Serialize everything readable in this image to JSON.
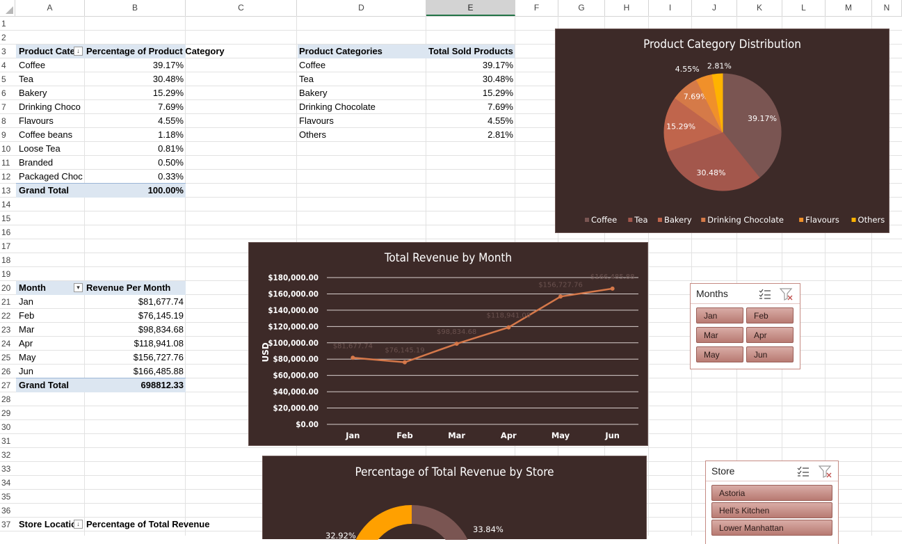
{
  "columns": [
    "A",
    "B",
    "C",
    "D",
    "E",
    "F",
    "G",
    "H",
    "I",
    "J",
    "K",
    "L",
    "M",
    "N"
  ],
  "selected_column": "E",
  "rows": [
    "1",
    "2",
    "3",
    "4",
    "5",
    "6",
    "7",
    "8",
    "9",
    "10",
    "11",
    "12",
    "13",
    "14",
    "15",
    "16",
    "17",
    "18",
    "19",
    "20",
    "21",
    "22",
    "23",
    "24",
    "25",
    "26",
    "27",
    "28",
    "29",
    "30",
    "31",
    "32",
    "33",
    "34",
    "35",
    "36",
    "37"
  ],
  "pivot_category": {
    "header_a": "Product Cate",
    "header_b": "Percentage of Product Category",
    "rows": [
      {
        "name": "Coffee",
        "pct": "39.17%"
      },
      {
        "name": "Tea",
        "pct": "30.48%"
      },
      {
        "name": "Bakery",
        "pct": "15.29%"
      },
      {
        "name": "Drinking Choco",
        "pct": "7.69%"
      },
      {
        "name": "Flavours",
        "pct": "4.55%"
      },
      {
        "name": "Coffee beans",
        "pct": "1.18%"
      },
      {
        "name": "Loose Tea",
        "pct": "0.81%"
      },
      {
        "name": "Branded",
        "pct": "0.50%"
      },
      {
        "name": "Packaged Choc",
        "pct": "0.33%"
      }
    ],
    "total_label": "Grand Total",
    "total_value": "100.00%"
  },
  "table_categories": {
    "header_d": "Product Categories",
    "header_e": "Total Sold Products",
    "rows": [
      {
        "name": "Coffee",
        "pct": "39.17%"
      },
      {
        "name": "Tea",
        "pct": "30.48%"
      },
      {
        "name": "Bakery",
        "pct": "15.29%"
      },
      {
        "name": "Drinking Chocolate",
        "pct": "7.69%"
      },
      {
        "name": "Flavours",
        "pct": "4.55%"
      },
      {
        "name": "Others",
        "pct": "2.81%"
      }
    ]
  },
  "pivot_month": {
    "header_a": "Month",
    "header_b": "Revenue Per Month",
    "rows": [
      {
        "name": "Jan",
        "value": "$81,677.74"
      },
      {
        "name": "Feb",
        "value": "$76,145.19"
      },
      {
        "name": "Mar",
        "value": "$98,834.68"
      },
      {
        "name": "Apr",
        "value": "$118,941.08"
      },
      {
        "name": "May",
        "value": "$156,727.76"
      },
      {
        "name": "Jun",
        "value": "$166,485.88"
      }
    ],
    "total_label": "Grand Total",
    "total_value": "698812.33"
  },
  "pivot_store": {
    "header_a": "Store Locatic",
    "header_b": "Percentage of Total Revenue"
  },
  "chart_data": [
    {
      "type": "pie",
      "title": "Product Category Distribution",
      "categories": [
        "Coffee",
        "Tea",
        "Bakery",
        "Drinking Chocolate",
        "Flavours",
        "Others"
      ],
      "values": [
        39.17,
        30.48,
        15.29,
        7.69,
        4.55,
        2.81
      ],
      "labels": [
        "39.17%",
        "30.48%",
        "15.29%",
        "7.69%",
        "4.55%",
        "2.81%"
      ],
      "colors": [
        "#7a5552",
        "#a3574c",
        "#c0654c",
        "#d57a48",
        "#f0902a",
        "#ffb300"
      ],
      "legend": "bottom"
    },
    {
      "type": "line",
      "title": "Total Revenue by Month",
      "categories": [
        "Jan",
        "Feb",
        "Mar",
        "Apr",
        "May",
        "Jun"
      ],
      "values": [
        81677.74,
        76145.19,
        98834.68,
        118941.08,
        156727.76,
        166485.88
      ],
      "data_labels": [
        "$81,677.74",
        "$76,145.19",
        "$98,834.68",
        "$118,941.08",
        "$156,727.76",
        "$166,485.88"
      ],
      "ylabel": "USD",
      "ylim": [
        0,
        180000
      ],
      "yticks": [
        "$0.00",
        "$20,000.00",
        "$40,000.00",
        "$60,000.00",
        "$80,000.00",
        "$100,000.00",
        "$120,000.00",
        "$140,000.00",
        "$160,000.00",
        "$180,000.00"
      ],
      "grid": true,
      "color": "#d5784a"
    },
    {
      "type": "pie",
      "title": "Percentage of Total Revenue by Store",
      "visible_labels": [
        "33.84%",
        "32.92%"
      ],
      "colors": [
        "#7a5552",
        "#ffa000"
      ]
    }
  ],
  "slicer_months": {
    "title": "Months",
    "items": [
      "Jan",
      "Feb",
      "Mar",
      "Apr",
      "May",
      "Jun"
    ]
  },
  "slicer_store": {
    "title": "Store",
    "items": [
      "Astoria",
      "Hell's Kitchen",
      "Lower Manhattan"
    ]
  },
  "icons": [
    "multi-select-icon",
    "clear-filter-icon",
    "filter-dropdown-icon"
  ]
}
